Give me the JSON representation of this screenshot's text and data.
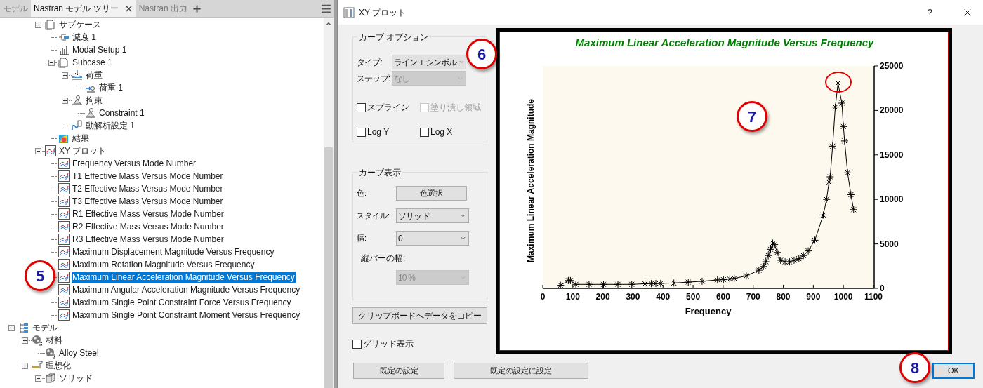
{
  "left_panel": {
    "tabs": [
      {
        "label": "モデル",
        "selected": false
      },
      {
        "label": "Nastran モデル ツリー",
        "selected": true
      },
      {
        "label": "Nastran 出力",
        "selected": false
      }
    ],
    "tree": [
      {
        "children": [
          {
            "children": [
              {
                "label": "サブケース",
                "kind": "document",
                "selected": false,
                "expanded": true,
                "children": [
                  {
                    "label": "減衰 1",
                    "kind": "damping",
                    "selected": false
                  },
                  {
                    "label": "Modal Setup 1",
                    "kind": "bars",
                    "selected": false
                  },
                  {
                    "label": "Subcase 1",
                    "kind": "document",
                    "selected": false,
                    "expanded": true,
                    "children": [
                      {
                        "label": "荷重",
                        "kind": "load",
                        "selected": false,
                        "expanded": true,
                        "children": [
                          {
                            "label": "荷重 1",
                            "kind": "load-arrow",
                            "selected": false
                          }
                        ]
                      },
                      {
                        "label": "拘束",
                        "kind": "constraint",
                        "selected": false,
                        "expanded": true,
                        "children": [
                          {
                            "label": "Constraint 1",
                            "kind": "constraint",
                            "selected": false
                          }
                        ]
                      },
                      {
                        "label": "動解析設定 1",
                        "kind": "dynamic",
                        "selected": false
                      }
                    ]
                  },
                  {
                    "label": "結果",
                    "kind": "result",
                    "selected": false
                  }
                ]
              },
              {
                "label": "XY プロット",
                "kind": "xy",
                "selected": false,
                "expanded": true,
                "children": [
                  {
                    "label": "Frequency Versus Mode Number",
                    "kind": "xy",
                    "selected": false
                  },
                  {
                    "label": "T1 Effective Mass Versus Mode Number",
                    "kind": "xy",
                    "selected": false
                  },
                  {
                    "label": "T2 Effective Mass Versus Mode Number",
                    "kind": "xy",
                    "selected": false
                  },
                  {
                    "label": "T3 Effective Mass Versus Mode Number",
                    "kind": "xy",
                    "selected": false
                  },
                  {
                    "label": "R1 Effective Mass Versus Mode Number",
                    "kind": "xy",
                    "selected": false
                  },
                  {
                    "label": "R2 Effective Mass Versus Mode Number",
                    "kind": "xy",
                    "selected": false
                  },
                  {
                    "label": "R3 Effective Mass Versus Mode Number",
                    "kind": "xy",
                    "selected": false
                  },
                  {
                    "label": "Maximum Displacement Magnitude Versus Frequency",
                    "kind": "xy",
                    "selected": false
                  },
                  {
                    "label": "Maximum Rotation Magnitude Versus Frequency",
                    "kind": "xy",
                    "selected": false
                  },
                  {
                    "label": "Maximum Linear Acceleration Magnitude Versus Frequency",
                    "kind": "xy",
                    "selected": true
                  },
                  {
                    "label": "Maximum Angular Acceleration Magnitude Versus Frequency",
                    "kind": "xy",
                    "selected": false
                  },
                  {
                    "label": "Maximum Single Point Constraint Force Versus Frequency",
                    "kind": "xy",
                    "selected": false
                  },
                  {
                    "label": "Maximum Single Point Constraint Moment Versus Frequency",
                    "kind": "xy",
                    "selected": false
                  }
                ]
              }
            ]
          }
        ]
      },
      {
        "label": "モデル",
        "kind": "model",
        "selected": false,
        "expanded": true,
        "children": [
          {
            "label": "材料",
            "kind": "material",
            "selected": false,
            "expanded": true,
            "children": [
              {
                "label": "Alloy Steel",
                "kind": "material",
                "selected": false
              }
            ]
          },
          {
            "label": "理想化",
            "kind": "idealize",
            "selected": false,
            "expanded": true,
            "children": [
              {
                "label": "ソリッド",
                "kind": "solid",
                "selected": false,
                "expanded": true
              }
            ]
          }
        ]
      }
    ]
  },
  "dialog": {
    "title": "XY プロット",
    "help": "?",
    "curve_options": {
      "legend": "カーブ オプション",
      "selects": [
        {
          "label": "タイプ:",
          "value": "ライン + シンボル",
          "disabled": false
        },
        {
          "label": "ステップ:",
          "value": "なし",
          "disabled": true
        }
      ],
      "checkboxes": [
        {
          "label": "スプライン",
          "checked": false,
          "disabled": false
        },
        {
          "label": "塗り潰し領域",
          "checked": false,
          "disabled": true
        },
        {
          "label": "Log Y",
          "checked": false,
          "disabled": false
        },
        {
          "label": "Log X",
          "checked": false,
          "disabled": false
        }
      ]
    },
    "curve_display": {
      "legend": "カーブ表示",
      "color_label": "色:",
      "color_button": "色選択",
      "selects": [
        {
          "label": "スタイル:",
          "value": "ソリッド",
          "disabled": false
        },
        {
          "label": "幅:",
          "value": "0",
          "disabled": false
        },
        {
          "label": "縦バーの幅:",
          "value": "10 %",
          "disabled": true
        }
      ]
    },
    "copy_button": "クリップボードへデータをコピー",
    "grid": {
      "label": "グリッド表示",
      "checked": false
    },
    "chart_data": {
      "type": "line",
      "title": "Maximum Linear Acceleration Magnitude Versus Frequency",
      "xlabel": "Frequency",
      "ylabel": "Maximum Linear Acceleration Magnitude",
      "xlim": [
        0,
        1100
      ],
      "ylim": [
        0,
        25000
      ],
      "xticks": [
        0,
        100,
        200,
        300,
        400,
        500,
        600,
        700,
        800,
        900,
        1000,
        1100
      ],
      "yticks": [
        0,
        5000,
        10000,
        15000,
        20000,
        25000
      ],
      "x": [
        59,
        85,
        92,
        110,
        154,
        202,
        250,
        296,
        340,
        361,
        376,
        392,
        436,
        484,
        530,
        581,
        601,
        622,
        637,
        677,
        719,
        734,
        742,
        750,
        758,
        765,
        771,
        780,
        791,
        806,
        821,
        836,
        852,
        867,
        883,
        905,
        933,
        944,
        952,
        956,
        964,
        973,
        982,
        995,
        1000,
        1004,
        1014,
        1025,
        1034
      ],
      "series": [
        {
          "color": "#000000",
          "marker": "cross",
          "values": [
            350,
            880,
            880,
            450,
            450,
            450,
            450,
            450,
            520,
            540,
            550,
            560,
            600,
            700,
            800,
            950,
            980,
            1050,
            1120,
            1400,
            2040,
            2460,
            3000,
            3690,
            4390,
            5090,
            4920,
            4040,
            3160,
            2980,
            2980,
            3160,
            3340,
            3690,
            4210,
            5410,
            8250,
            10000,
            11940,
            12540,
            15980,
            20370,
            23070,
            20820,
            18190,
            16570,
            12990,
            10530,
            8850
          ]
        }
      ]
    },
    "buttons": [
      {
        "label": "既定の設定",
        "focused": false
      },
      {
        "label": "既定の設定に設定",
        "focused": false
      },
      {
        "label": "OK",
        "focused": true
      }
    ]
  },
  "callouts": [
    {
      "kind": "number",
      "label": "5"
    },
    {
      "kind": "number",
      "label": "6"
    },
    {
      "kind": "number",
      "label": "7"
    },
    {
      "kind": "number",
      "label": "8"
    },
    {
      "kind": "ring"
    }
  ]
}
